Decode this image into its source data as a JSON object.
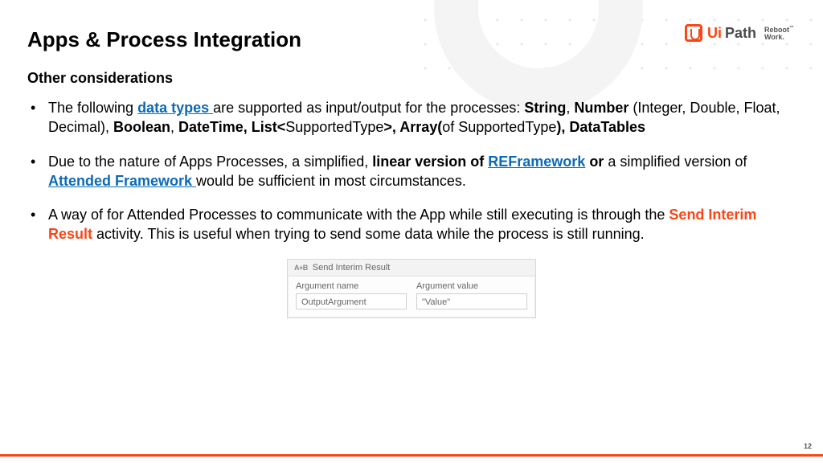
{
  "logo": {
    "ui": "Ui",
    "path": "Path",
    "tag_line1": "Reboot",
    "tag_line2": "Work."
  },
  "title": "Apps & Process Integration",
  "subtitle": "Other considerations",
  "bullet1": {
    "t1": "The following ",
    "link": "data types ",
    "t2": "are supported as input/output for the processes: ",
    "b1": "String",
    "c1": ", ",
    "b2": "Number",
    "t3": " (Integer, Double, Float, Decimal), ",
    "b3": "Boolean",
    "c2": ", ",
    "b4": "DateTime, List<",
    "t4": "SupportedType",
    "b5": ">, Array(",
    "t5": "of SupportedType",
    "b6": "), DataTables"
  },
  "bullet2": {
    "t1": "Due to the nature of Apps Processes, a simplified, ",
    "b1": "linear version of ",
    "link1": "REFramework",
    "b2": " or ",
    "t2": "a simplified version of ",
    "link2": "Attended Framework ",
    "t3": "would be sufficient in most circumstances."
  },
  "bullet3": {
    "t1": "A way of for Attended Processes to communicate with the App while still executing is through the ",
    "ob": "Send Interim Result",
    "t2": " activity. This is useful when trying to send some data while the process is still running."
  },
  "activity": {
    "icon": "A+B",
    "title": "Send Interim Result",
    "col1_label": "Argument name",
    "col1_value": "OutputArgument",
    "col2_label": "Argument value",
    "col2_value": "\"Value\""
  },
  "page_number": "12"
}
